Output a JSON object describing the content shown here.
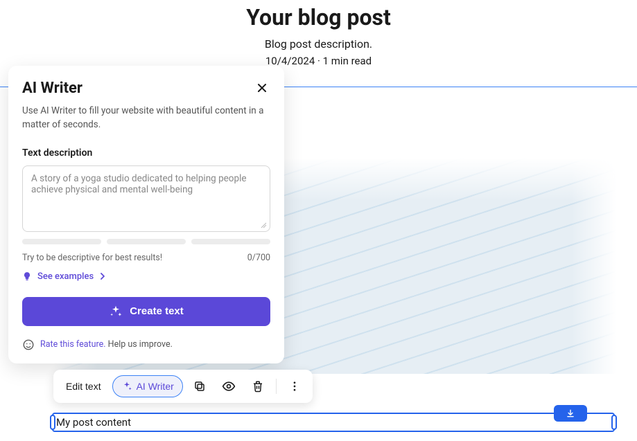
{
  "header": {
    "title": "Your blog post",
    "description": "Blog post description.",
    "meta": "10/4/2024 · 1 min read"
  },
  "aiWriter": {
    "title": "AI Writer",
    "subtitle": "Use AI Writer to fill your website with beautiful content in a matter of seconds.",
    "label": "Text description",
    "placeholder": "A story of a yoga studio dedicated to helping people achieve physical and mental well-being",
    "hint": "Try to be descriptive for best results!",
    "counter": "0/700",
    "examplesLabel": "See examples",
    "createLabel": "Create text",
    "rateLink": "Rate this feature.",
    "rateSuffix": "Help us improve."
  },
  "toolbar": {
    "editText": "Edit text",
    "aiWriter": "AI Writer"
  },
  "content": {
    "body": "My post content"
  },
  "icons": {
    "close": "close-icon",
    "bulb": "bulb-icon",
    "chevronRight": "chevron-right-icon",
    "sparkle": "sparkle-icon",
    "smiley": "smiley-icon",
    "copy": "copy-icon",
    "eye": "eye-icon",
    "trash": "trash-icon",
    "more": "more-vertical-icon",
    "download": "download-icon"
  },
  "colors": {
    "primary": "#5b48d8",
    "selection": "#2563eb"
  }
}
